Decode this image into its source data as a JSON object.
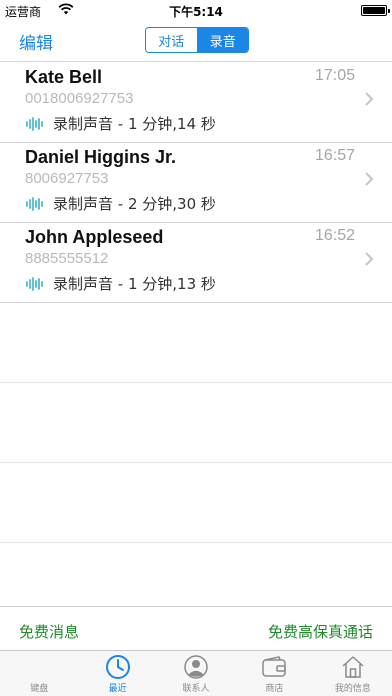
{
  "status_bar": {
    "carrier": "运营商",
    "time": "下午5:14"
  },
  "nav": {
    "edit_label": "编辑",
    "segments": [
      "对话",
      "录音"
    ],
    "active_segment": "录音"
  },
  "recordings": [
    {
      "name": "Kate Bell",
      "number": "0018006927753",
      "time": "17:05",
      "recording": "录制声音 - 1 分钟,14 秒"
    },
    {
      "name": "Daniel Higgins Jr.",
      "number": "8006927753",
      "time": "16:57",
      "recording": "录制声音 - 2 分钟,30 秒"
    },
    {
      "name": "John Appleseed",
      "number": "8885555512",
      "time": "16:52",
      "recording": "录制声音 - 1 分钟,13 秒"
    }
  ],
  "promo": {
    "left": "免费消息",
    "right": "免费高保真通话"
  },
  "tabs": [
    {
      "label": "键盘",
      "icon": "keypad-icon"
    },
    {
      "label": "最近",
      "icon": "recent-clock-icon"
    },
    {
      "label": "联系人",
      "icon": "contacts-icon"
    },
    {
      "label": "商店",
      "icon": "wallet-icon"
    },
    {
      "label": "我的信息",
      "icon": "home-icon"
    }
  ],
  "active_tab": "最近",
  "colors": {
    "accent": "#1a86e6",
    "promo_green": "#1f8a2a",
    "waveform": "#5fc1d3"
  }
}
